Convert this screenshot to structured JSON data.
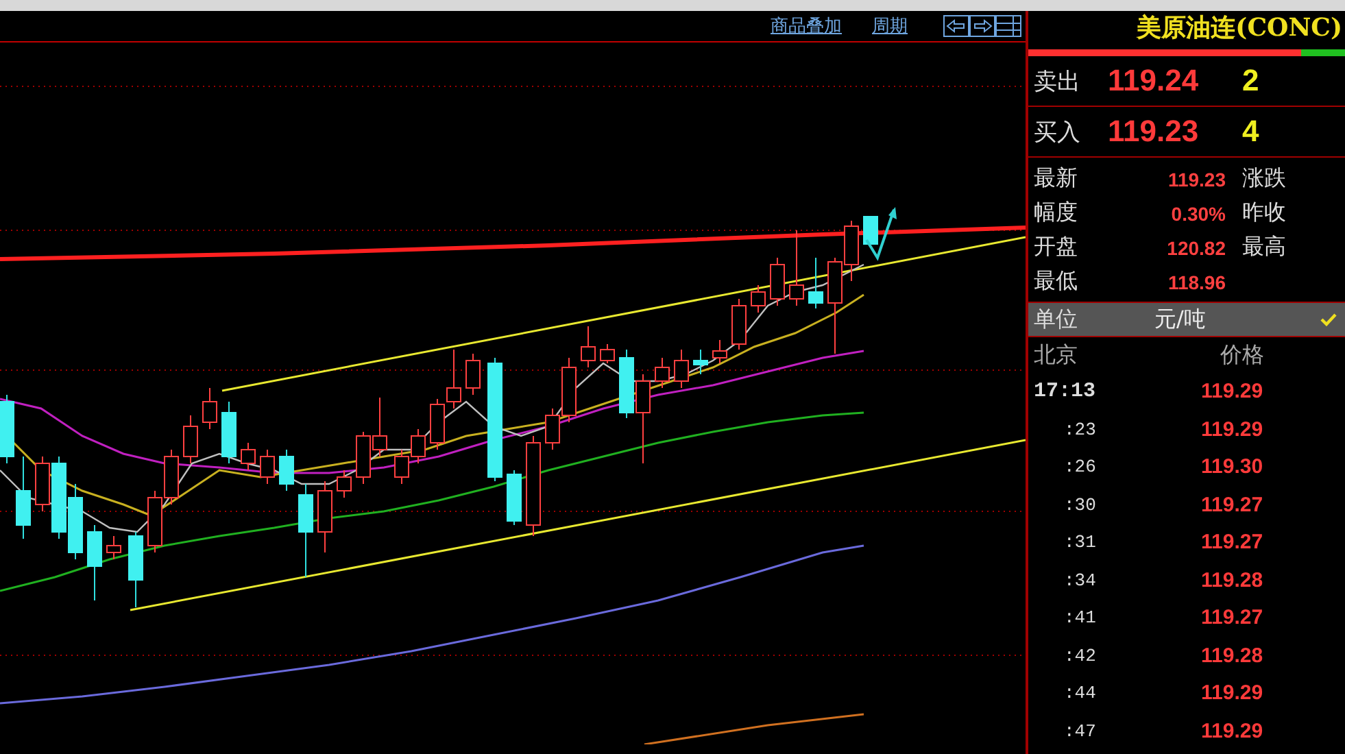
{
  "chart_header": {
    "links": [
      "商品叠加",
      "周期"
    ]
  },
  "quote": {
    "title": "美原油连(CONC)",
    "strength_bar": {
      "level": 0.86
    },
    "ask": {
      "label": "卖出",
      "price": "119.24",
      "volume": "2"
    },
    "bid": {
      "label": "买入",
      "price": "119.23",
      "volume": "4"
    },
    "stats": [
      {
        "label": "最新",
        "value": "119.23",
        "label_2": "涨跌"
      },
      {
        "label": "幅度",
        "value": "0.30%",
        "label_2": "昨收"
      },
      {
        "label": "开盘",
        "value": "120.82",
        "label_2": "最高"
      },
      {
        "label": "最低",
        "value": "118.96"
      }
    ],
    "unit": {
      "label": "单位",
      "value": "元/吨",
      "checked": true
    },
    "ticks_header": {
      "time": "北京",
      "price": "价格"
    },
    "ticks": [
      {
        "kind": "full",
        "time": "17:13",
        "price": "119.29"
      },
      {
        "kind": "minute",
        "time": ":23",
        "price": "119.29"
      },
      {
        "kind": "minute",
        "time": ":26",
        "price": "119.30"
      },
      {
        "kind": "minute",
        "time": ":30",
        "price": "119.27"
      },
      {
        "kind": "minute",
        "time": ":31",
        "price": "119.27"
      },
      {
        "kind": "minute",
        "time": ":34",
        "price": "119.28"
      },
      {
        "kind": "minute",
        "time": ":41",
        "price": "119.27"
      },
      {
        "kind": "minute",
        "time": ":42",
        "price": "119.28"
      },
      {
        "kind": "minute",
        "time": ":44",
        "price": "119.29"
      },
      {
        "kind": "minute",
        "time": ":47",
        "price": "119.29"
      }
    ]
  }
}
